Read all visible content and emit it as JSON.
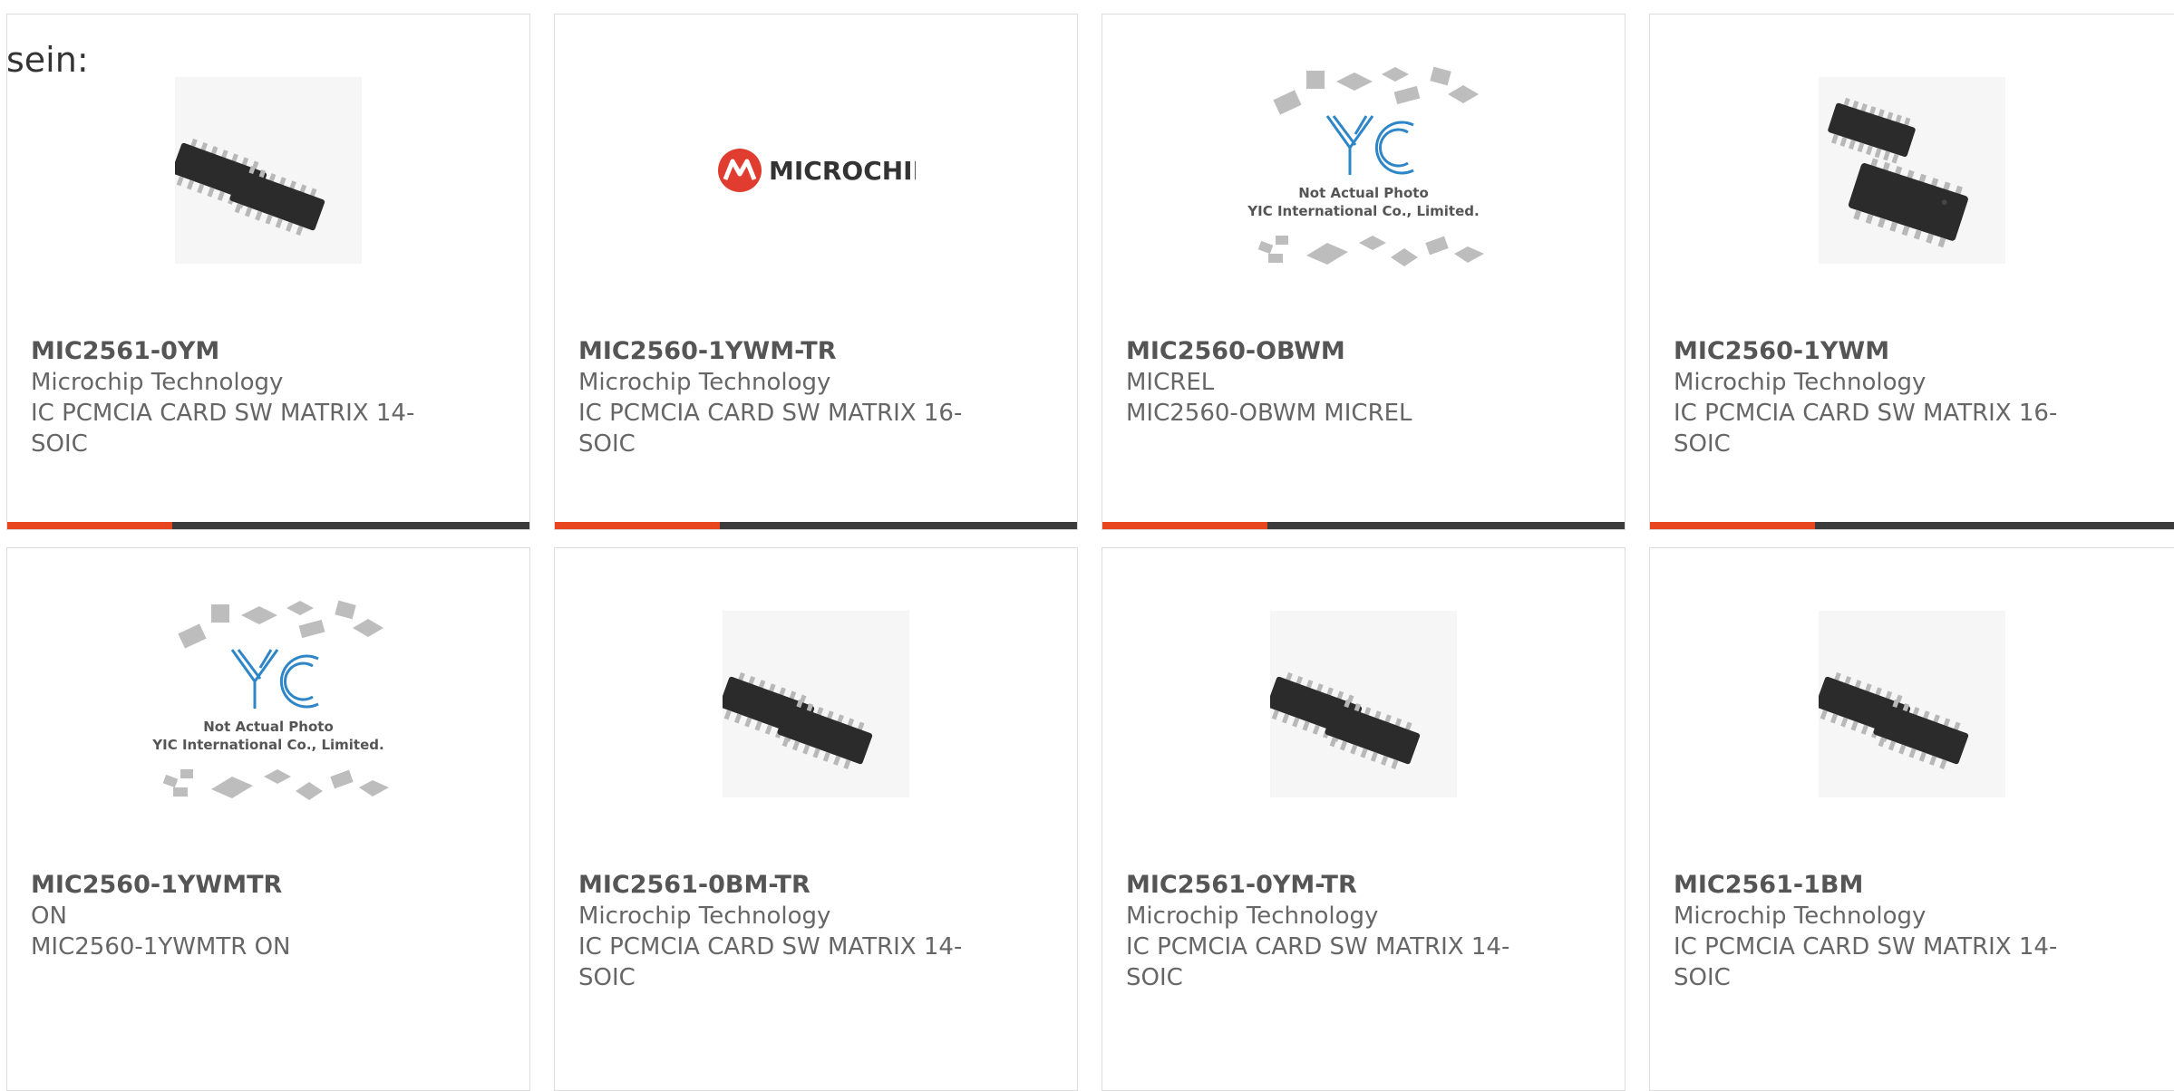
{
  "intro_text": "sein:",
  "colors": {
    "accent": "#e8461e",
    "bar_dark": "#3c3c3c",
    "text": "#666666",
    "yic_blue": "#2e86c8",
    "microchip_red": "#e03c2f"
  },
  "products": [
    {
      "part_number": "MIC2561-0YM",
      "manufacturer": "Microchip Technology",
      "description": "IC PCMCIA CARD SW MATRIX 14-SOIC",
      "image": "soic-14-chip-photo"
    },
    {
      "part_number": "MIC2560-1YWM-TR",
      "manufacturer": "Microchip Technology",
      "description": "IC PCMCIA CARD SW MATRIX 16-SOIC",
      "image": "microchip-logo",
      "logo_text": "MICROCHIP"
    },
    {
      "part_number": "MIC2560-OBWM",
      "manufacturer": "MICREL",
      "description": "MIC2560-OBWM MICREL",
      "image": "yic-placeholder",
      "placeholder_line1": "Not Actual Photo",
      "placeholder_line2": "YIC International Co., Limited."
    },
    {
      "part_number": "MIC2560-1YWM",
      "manufacturer": "Microchip Technology",
      "description": "IC PCMCIA CARD SW MATRIX 16-SOIC",
      "image": "soic-16-chip-photo"
    },
    {
      "part_number": "MIC2560-1YWMTR",
      "manufacturer": "ON",
      "description": "MIC2560-1YWMTR ON",
      "image": "yic-placeholder",
      "placeholder_line1": "Not Actual Photo",
      "placeholder_line2": "YIC International Co., Limited."
    },
    {
      "part_number": "MIC2561-0BM-TR",
      "manufacturer": "Microchip Technology",
      "description": "IC PCMCIA CARD SW MATRIX 14-SOIC",
      "image": "soic-14-chip-photo"
    },
    {
      "part_number": "MIC2561-0YM-TR",
      "manufacturer": "Microchip Technology",
      "description": "IC PCMCIA CARD SW MATRIX 14-SOIC",
      "image": "soic-14-chip-photo"
    },
    {
      "part_number": "MIC2561-1BM",
      "manufacturer": "Microchip Technology",
      "description": "IC PCMCIA CARD SW MATRIX 14-SOIC",
      "image": "soic-14-chip-photo"
    }
  ]
}
